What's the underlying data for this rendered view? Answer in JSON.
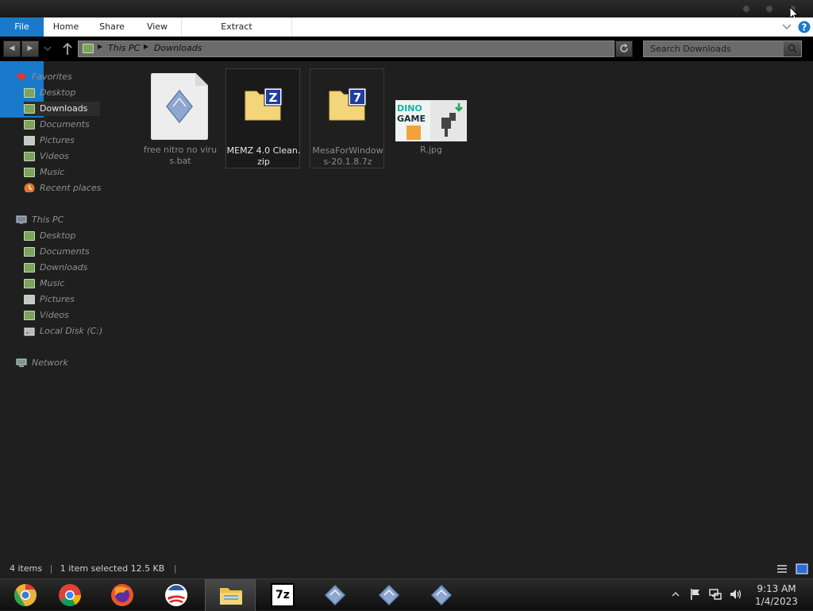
{
  "ribbon": {
    "tabs": [
      {
        "label": "File"
      },
      {
        "label": "Home"
      },
      {
        "label": "Share"
      },
      {
        "label": "View"
      },
      {
        "label": "Extract"
      }
    ]
  },
  "address": {
    "crumbs": [
      "This PC",
      "Downloads"
    ]
  },
  "search": {
    "placeholder": "Search Downloads"
  },
  "sidebar": {
    "favorites": {
      "label": "Favorites",
      "items": [
        {
          "label": "Desktop"
        },
        {
          "label": "Downloads"
        },
        {
          "label": "Documents"
        },
        {
          "label": "Pictures"
        },
        {
          "label": "Videos"
        },
        {
          "label": "Music"
        },
        {
          "label": "Recent places"
        }
      ]
    },
    "thispc": {
      "label": "This PC",
      "items": [
        {
          "label": "Desktop"
        },
        {
          "label": "Documents"
        },
        {
          "label": "Downloads"
        },
        {
          "label": "Music"
        },
        {
          "label": "Pictures"
        },
        {
          "label": "Videos"
        },
        {
          "label": "Local Disk (C:)"
        }
      ]
    },
    "network": {
      "label": "Network"
    }
  },
  "files": [
    {
      "name": "free nitro no virus.bat",
      "icon": "batch-file-icon"
    },
    {
      "name": "MEMZ 4.0 Clean.zip",
      "icon": "zip-archive-icon",
      "badge": "Z"
    },
    {
      "name": "MesaForWindows-20.1.8.7z",
      "icon": "7z-archive-icon",
      "badge": "7"
    },
    {
      "name": "R.jpg",
      "icon": "image-thumbnail",
      "thumb_text_1": "DINO",
      "thumb_text_2": "GAME"
    }
  ],
  "status": {
    "count": "4 items",
    "selection": "1 item selected  12.5 KB"
  },
  "taskbar": {
    "apps": [
      "chrome-canary-icon",
      "chrome-icon",
      "firefox-icon",
      "obama-logo-icon",
      "file-explorer-icon",
      "7zip-icon",
      "batch-file-icon",
      "batch-file-icon",
      "batch-file-icon"
    ],
    "sevenzip_label": "7z",
    "time": "9:13 AM",
    "date": "1/4/2023"
  },
  "colors": {
    "accent": "#1979ca",
    "background": "#1f1f1f",
    "folder": "#f3d67a"
  }
}
